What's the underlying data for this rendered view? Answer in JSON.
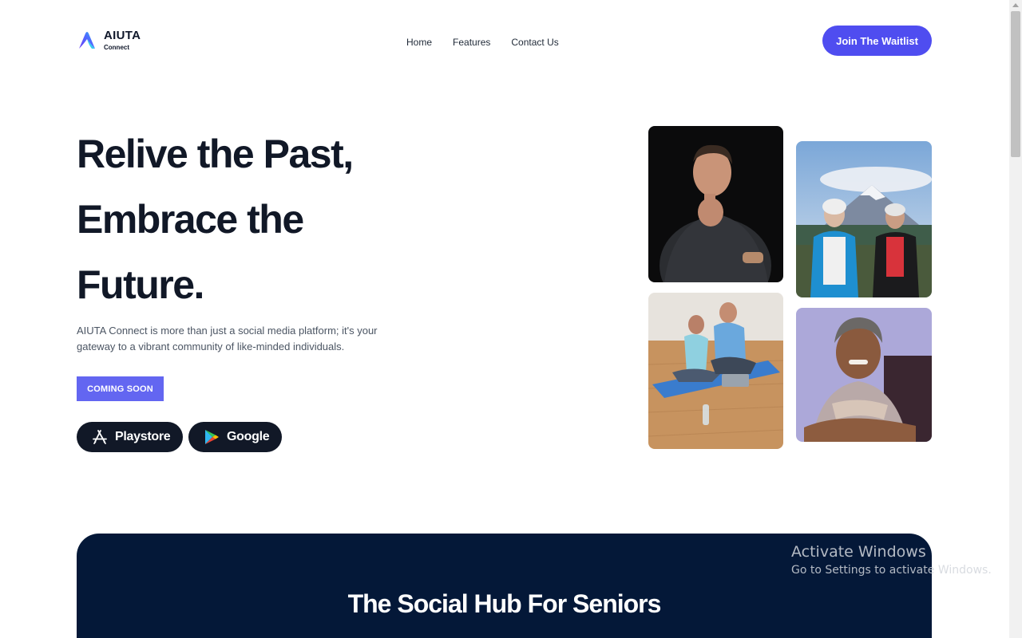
{
  "brand": {
    "name": "AIUTA",
    "sub": "Connect",
    "logo_icon": "aiuta-a-logo"
  },
  "nav": {
    "items": [
      "Home",
      "Features",
      "Contact Us"
    ]
  },
  "header": {
    "cta_label": "Join The Waitlist"
  },
  "hero": {
    "title_lines": [
      "Relive the Past,",
      "Embrace the",
      "Future."
    ],
    "description": "AIUTA Connect is more than just a social media platform; it's your gateway to a vibrant community of like-minded individuals.",
    "badge": "COMING SOON",
    "stores": [
      {
        "label": "Playstore",
        "icon": "app-store-icon"
      },
      {
        "label": "Google",
        "icon": "google-play-icon"
      }
    ]
  },
  "photos": [
    {
      "name": "man-in-dark-shirt-photo"
    },
    {
      "name": "two-seniors-mountain-photo"
    },
    {
      "name": "couple-on-yoga-mat-photo"
    },
    {
      "name": "smiling-senior-woman-photo"
    }
  ],
  "section": {
    "title": "The Social Hub For Seniors"
  },
  "watermark": {
    "title": "Activate Windows",
    "subtitle": "Go to Settings to activate Windows."
  },
  "colors": {
    "accent": "#4f4df0",
    "badge": "#6366f1",
    "dark": "#041838",
    "text": "#111827"
  }
}
